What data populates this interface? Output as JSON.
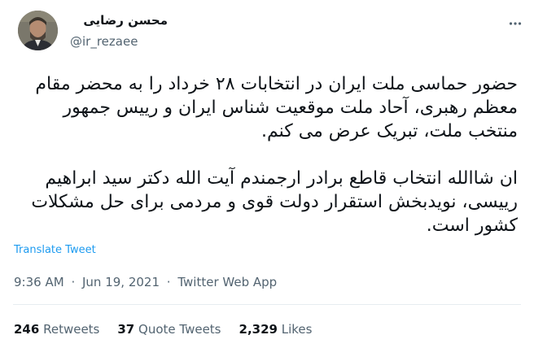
{
  "author": {
    "display_name": "محسن رضایی",
    "handle": "@ir_rezaee"
  },
  "tweet": {
    "paragraph_1": "حضور حماسی ملت ایران در انتخابات ۲۸ خرداد را به محضر مقام معظم رهبری، آحاد ملت موقعیت شناس ایران و رییس جمهور منتخب ملت، تبریک عرض می کنم.",
    "paragraph_2": "ان شاالله انتخاب قاطع برادر ارجمندم آیت الله دکتر سید ابراهیم رییسی، نویدبخش استقرار دولت قوی و مردمی برای حل مشکلات کشور است.",
    "translate_label": "Translate Tweet"
  },
  "meta": {
    "time": "9:36 AM",
    "separator": "·",
    "date": "Jun 19, 2021",
    "source": "Twitter Web App"
  },
  "stats": {
    "retweets_count": "246",
    "retweets_label": "Retweets",
    "quotes_count": "37",
    "quotes_label": "Quote Tweets",
    "likes_count": "2,329",
    "likes_label": "Likes"
  },
  "icons": {
    "more": "more-options-icon",
    "avatar": "avatar"
  }
}
